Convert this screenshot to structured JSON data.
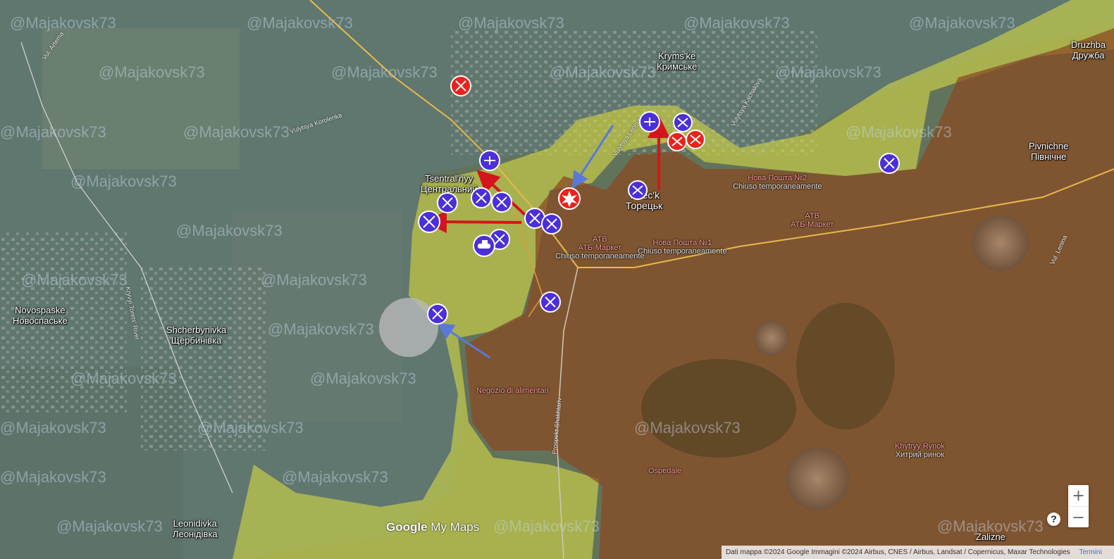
{
  "map": {
    "places": [
      {
        "name": "Kryms'ke",
        "local": "Кримське",
        "id": "krymske"
      },
      {
        "name": "Tsentral'nyy",
        "local": "Центральний",
        "id": "tsentralnyy"
      },
      {
        "name": "Torec'k",
        "local": "Торецьк",
        "id": "toretsk"
      },
      {
        "name": "Pivnichne",
        "local": "Північне",
        "id": "pivnichne"
      },
      {
        "name": "Druzhba",
        "local": "Дружба",
        "id": "druzhba"
      },
      {
        "name": "Novospaske",
        "local": "Новоспаське",
        "id": "novospaske"
      },
      {
        "name": "Shcherbynivka",
        "local": "Щербинівка",
        "id": "shcherbynivka"
      },
      {
        "name": "Leonidivka",
        "local": "Леонідівка",
        "id": "leonidivka"
      },
      {
        "name": "Zalizne",
        "local": "",
        "id": "zalizne"
      }
    ],
    "streets": [
      {
        "name": "Vul. Artema",
        "id": "artema"
      },
      {
        "name": "Vulytsya Korolenka",
        "id": "korolenka"
      },
      {
        "name": "Vulytsya Kachalova",
        "id": "kachalova"
      },
      {
        "name": "Vulytsya Lenina",
        "id": "lenina-n"
      },
      {
        "name": "Kryvyi Torets' River",
        "id": "river"
      },
      {
        "name": "Prospekt Shakhtariv",
        "id": "shakhtariv"
      },
      {
        "name": "Vul. Lenina",
        "id": "lenina-e"
      }
    ],
    "pois": [
      {
        "name": "Нова Пошта №2",
        "status": "Chiuso temporaneamente",
        "id": "np2"
      },
      {
        "name": "Нова Пошта №1",
        "status": "Chiuso temporaneamente",
        "id": "np1"
      },
      {
        "name": "ATB",
        "status": "АТБ-Маркет",
        "id": "atb-east"
      },
      {
        "name": "ATB",
        "status": "АТБ-Маркет",
        "extra": "Chiuso temporaneamente",
        "id": "atb-center"
      },
      {
        "name": "Negozio di alimentari",
        "status": "",
        "id": "negozio"
      },
      {
        "name": "Khytryy Rynok",
        "status": "Хитрий ринок",
        "id": "rynok"
      },
      {
        "name": "Ospedale",
        "status": "",
        "id": "ospedale"
      }
    ],
    "watermark_text": "@Majakovsk73",
    "colors": {
      "russian_control": "#8a4a22",
      "contested": "#d6d84a",
      "ukraine_unit": "#4b2fd8",
      "russian_unit": "#e8231e",
      "attack_arrow_red": "#d3161b",
      "attack_arrow_blue": "#5a78d8"
    },
    "unit_icons": [
      "drone-icon",
      "infantry-icon",
      "tank-icon",
      "explosion-icon"
    ]
  },
  "controls": {
    "zoom_in": "+",
    "zoom_out": "−",
    "help": "?"
  },
  "footer": {
    "logo_google": "Google",
    "logo_mymaps": "My Maps",
    "attribution": "Dati mappa ©2024 Google Immagini ©2024 Airbus, CNES / Airbus, Landsat / Copernicus, Maxar Technologies",
    "terms": "Termini"
  }
}
